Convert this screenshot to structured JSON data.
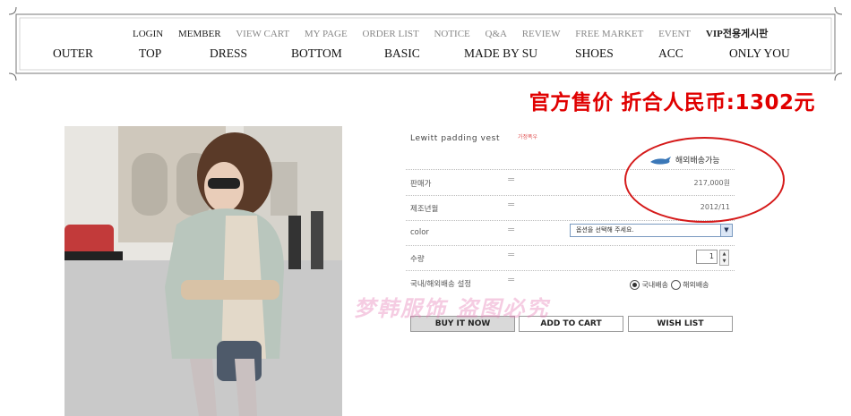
{
  "top_links": [
    "LOGIN",
    "MEMBER",
    "VIEW CART",
    "MY PAGE",
    "ORDER LIST",
    "NOTICE",
    "Q&A",
    "REVIEW",
    "FREE MARKET",
    "EVENT",
    "VIP전용게시판"
  ],
  "categories": [
    "OUTER",
    "TOP",
    "DRESS",
    "BOTTOM",
    "BASIC",
    "MADE BY SU",
    "SHOES",
    "ACC",
    "ONLY YOU"
  ],
  "overlay_price": "官方售价 折合人民币:1302元",
  "product": {
    "name": "Lewitt padding vest",
    "badge": "가정폭우",
    "shipping_note": "해외배송가능",
    "rows": [
      {
        "label": "판매가",
        "value": "217,000원"
      },
      {
        "label": "제조년월",
        "value": "2012/11"
      },
      {
        "label": "color",
        "value": ""
      },
      {
        "label": "수량",
        "value": ""
      },
      {
        "label": "국내/해외배송 설정",
        "value": ""
      }
    ],
    "eq_sign": "=",
    "select_placeholder": "옵션을 선택해 주세요.",
    "quantity": "1",
    "ship_domestic": "국내배송",
    "ship_overseas": "해외배송"
  },
  "buttons": {
    "buy": "BUY IT NOW",
    "cart": "ADD TO CART",
    "wish": "WISH LIST"
  },
  "watermark": "梦韩服饰 盗图必究"
}
